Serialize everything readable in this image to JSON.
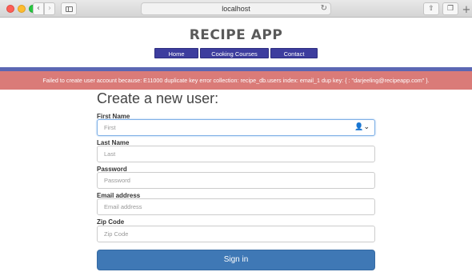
{
  "browser": {
    "url": "localhost",
    "back_icon": "‹",
    "forward_icon": "›",
    "reload_icon": "↻",
    "share_icon": "⇧",
    "tabs_icon": "❐",
    "new_tab_icon": "+"
  },
  "site": {
    "title": "RECIPE APP",
    "nav": {
      "home": "Home",
      "courses": "Cooking Courses",
      "contact": "Contact"
    },
    "nav_color": "#3d3d9e"
  },
  "alert": {
    "message": "Failed to create user account because: E11000 duplicate key error collection: recipe_db.users index: email_1 dup key: { : \"darjeeling@recipeapp.com\" }.",
    "color": "#da7b78"
  },
  "form": {
    "title": "Create a new user:",
    "first_name": {
      "label": "First Name",
      "placeholder": "First",
      "autofill_icon": "👤⌄"
    },
    "last_name": {
      "label": "Last Name",
      "placeholder": "Last"
    },
    "password": {
      "label": "Password",
      "placeholder": "Password"
    },
    "email": {
      "label": "Email address",
      "placeholder": "Email address"
    },
    "zip": {
      "label": "Zip Code",
      "placeholder": "Zip Code"
    },
    "submit_label": "Sign in",
    "submit_color": "#3f78b5"
  }
}
